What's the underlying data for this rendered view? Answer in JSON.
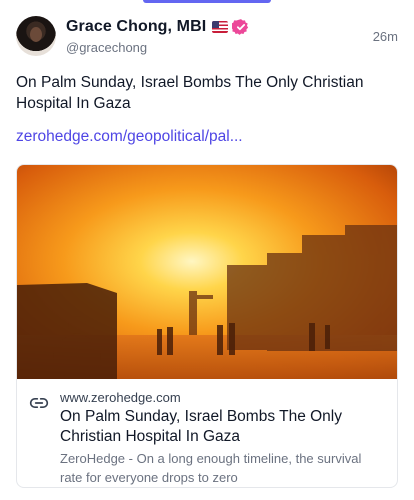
{
  "author": {
    "display_name": "Grace Chong, MBI",
    "flag": "🇺🇸",
    "handle": "@gracechong",
    "time": "26m"
  },
  "post": {
    "text": "On Palm Sunday, Israel Bombs The Only Christian Hospital In Gaza",
    "link_text": "zerohedge.com/geopolitical/pal..."
  },
  "link_card": {
    "domain": "www.zerohedge.com",
    "title": "On Palm Sunday, Israel Bombs The Only Christian Hospital In Gaza",
    "description": "ZeroHedge - On a long enough timeline, the survival rate for everyone drops to zero"
  },
  "colors": {
    "accent": "#6366f1",
    "link": "#4f46e5",
    "verified_badge": "#ec4899"
  },
  "icons": {
    "verified": "verified-badge-icon",
    "link": "link-icon"
  }
}
